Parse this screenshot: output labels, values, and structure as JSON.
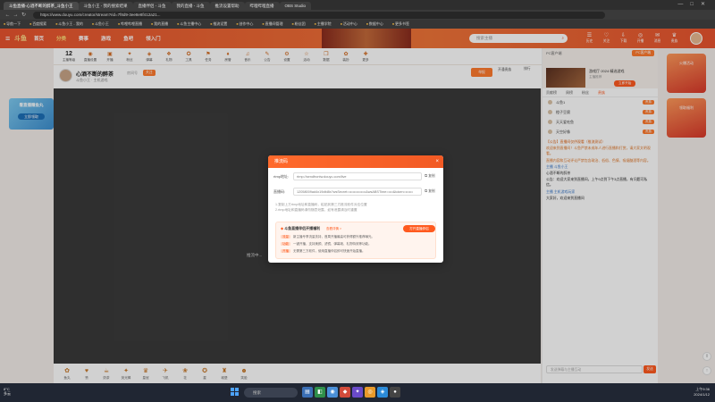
{
  "browser": {
    "tabs": [
      {
        "label": "斗鱼直播-心酒不断的醉茶_斗鱼小王",
        "active": true
      },
      {
        "label": "斗鱼小王 - 我的搜索结果"
      },
      {
        "label": "直播伴侣 - 斗鱼"
      },
      {
        "label": "我的直播 - 斗鱼"
      },
      {
        "label": "推流设置帮助"
      },
      {
        "label": "哔哩哔哩直播"
      },
      {
        "label": "OBS Studio"
      }
    ],
    "url": "https://www.douyu.com/creator/stream?rid=7f8d9-3ee8e8f412a21...",
    "bookmarks": [
      "导航一下",
      "百度搜索",
      "斗鱼小王 - 我的",
      "斗鱼小王",
      "哔哩哔哩直播",
      "我的直播",
      "斗鱼主播中心",
      "推流设置",
      "创作中心",
      "直播间管理",
      "粉丝团",
      "主播学院",
      "活动中心",
      "数据中心",
      "更多书签"
    ]
  },
  "site": {
    "logo": "斗鱼",
    "nav": [
      "首页",
      "分类",
      "赛事",
      "游戏",
      "鱼吧",
      "领入门"
    ],
    "nav_active_index": 1,
    "search_placeholder": "搜索主播",
    "header_icons": [
      {
        "glyph": "☰",
        "label": "历史"
      },
      {
        "glyph": "♡",
        "label": "关注"
      },
      {
        "glyph": "⇩",
        "label": "下载"
      },
      {
        "glyph": "◎",
        "label": "开播"
      },
      {
        "glyph": "✉",
        "label": "消息"
      },
      {
        "glyph": "♛",
        "label": "贵族"
      }
    ]
  },
  "left_ad": {
    "text": "看直播赚鱼丸",
    "button": "立即领取"
  },
  "room": {
    "channels": [
      {
        "glyph": "12",
        "label": "主播等级"
      },
      {
        "glyph": "◉",
        "label": "直播设置"
      },
      {
        "glyph": "▣",
        "label": "开播"
      },
      {
        "glyph": "✦",
        "label": "粉丝"
      },
      {
        "glyph": "◈",
        "label": "弹幕"
      },
      {
        "glyph": "❖",
        "label": "礼物"
      },
      {
        "glyph": "✪",
        "label": "工具"
      },
      {
        "glyph": "⚑",
        "label": "任务"
      },
      {
        "glyph": "♦",
        "label": "房管"
      },
      {
        "glyph": "♫",
        "label": "音乐"
      },
      {
        "glyph": "✎",
        "label": "公告"
      },
      {
        "glyph": "⚙",
        "label": "设置"
      },
      {
        "glyph": "☆",
        "label": "活动"
      },
      {
        "glyph": "❒",
        "label": "数据"
      },
      {
        "glyph": "✿",
        "label": "装扮"
      },
      {
        "glyph": "✚",
        "label": "更多"
      }
    ],
    "title": "心酒不断的醉茶",
    "room_id": "房间号",
    "follow": "关注",
    "subtitle": "斗鱼小王 · 主机游戏",
    "report": "举报",
    "vip": "开通贵族",
    "rank": "排行",
    "gift": "送礼"
  },
  "player": {
    "hint": "推流中..."
  },
  "gifts": [
    {
      "glyph": "✿",
      "label": "鱼丸"
    },
    {
      "glyph": "♥",
      "label": "赞"
    },
    {
      "glyph": "☕",
      "label": "奶茶"
    },
    {
      "glyph": "✦",
      "label": "荧光棒"
    },
    {
      "glyph": "♛",
      "label": "皇冠"
    },
    {
      "glyph": "✈",
      "label": "飞机"
    },
    {
      "glyph": "❀",
      "label": "花"
    },
    {
      "glyph": "✪",
      "label": "星"
    },
    {
      "glyph": "♜",
      "label": "城堡"
    },
    {
      "glyph": "☻",
      "label": "笑脸"
    }
  ],
  "right_panel": {
    "topline": "PC客户端",
    "pc_tag": "PC客户端",
    "game_title": "游戏厅·2024·精选游戏",
    "game_sub": "主播推荐",
    "game_button": "立即开始",
    "tabs": [
      "贡献榜",
      "周榜",
      "粉丝",
      "贵族"
    ],
    "tab_active_index": 3,
    "ranks": [
      {
        "name": "斗鱼1",
        "tag": "贵族"
      },
      {
        "name": "橙子豆腐",
        "tag": "贵族"
      },
      {
        "name": "天天爱吃鱼",
        "tag": "贵族"
      },
      {
        "name": "天空好像",
        "tag": "贵族"
      }
    ],
    "chat": [
      {
        "cls": "notice-title",
        "text": "【公告】直播间仅供观看（推流测试）"
      },
      {
        "cls": "",
        "text": "欢迎来到直播间！斗鱼严禁未成年人进行直播和打赏，请大家文明观看。"
      },
      {
        "cls": "",
        "text": "直播内容和互动评论严禁包含政治、低俗、色情、吸烟酗酒等内容。"
      },
      {
        "cls": "user",
        "text": "主播 斗鱼小王"
      },
      {
        "cls": "plain",
        "text": "心酒不断的醉茶"
      },
      {
        "cls": "plain",
        "text": "公告：欢迎大家来到直播间，上午9点到下午3点直播，有问题可私信。"
      },
      {
        "cls": "user",
        "text": "主播 主机游戏玩家"
      },
      {
        "cls": "plain",
        "text": "大家好，欢迎来到直播间"
      }
    ],
    "input_placeholder": "发送弹幕与主播互动",
    "send": "发送"
  },
  "far_right": {
    "card1": "火爆活动",
    "card2": "领取福利"
  },
  "modal": {
    "title": "推流码",
    "close": "×",
    "fields": [
      {
        "label": "rtmp地址:",
        "value": "rtmp://sendfrontw.douyu.com/live",
        "copy": "复制"
      },
      {
        "label": "直播码:",
        "value": "12058009ad4x19dfd8x?wsSecret=••••••••••••••&wsABSTime=••••&token=••••••",
        "copy": "复制"
      }
    ],
    "hints": [
      "1.复制上方rtmp地址和直播码，粘贴到第三方推流软件对应位置",
      "2.rtmp地址和直播码请勿随意泄露，如有泄露请及时重置"
    ],
    "promo": {
      "title": "斗鱼直播伴侣开播福利",
      "detail": "查看详情 >",
      "open": "打开直播伴侣",
      "lines": [
        {
          "tag": "流量",
          "text": "新主播专享流量扶持，首周开播最高可获得额外推荐曝光。"
        },
        {
          "tag": "功能",
          "text": "一键开播，支持美颜、滤镜、弹幕姬、礼物特效等功能。"
        },
        {
          "tag": "开播",
          "text": "无需第三方软件，使用直播伴侣即可快速开始直播。"
        }
      ]
    }
  },
  "taskbar": {
    "weather_temp": "8°C",
    "weather_desc": "多云",
    "search": "搜索",
    "time": "上午9:36",
    "date": "2024/1/12"
  },
  "colors": {
    "accent": "#f25a24",
    "header": "#e8542f",
    "taskbar": "#202633"
  }
}
